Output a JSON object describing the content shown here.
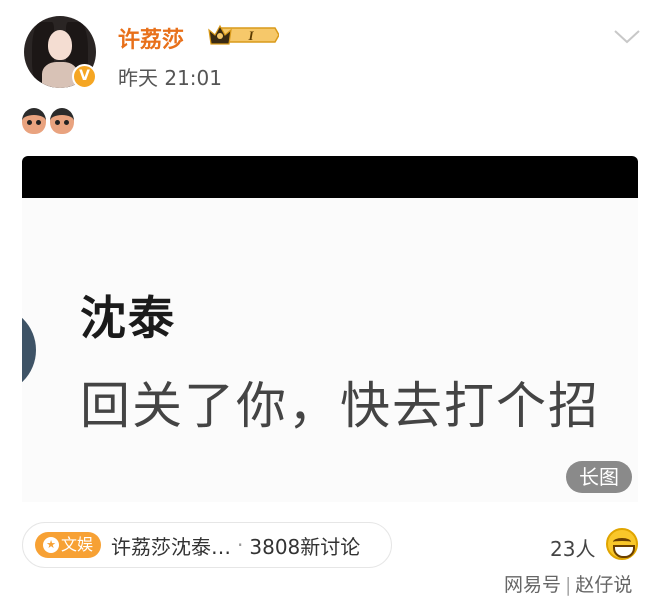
{
  "post": {
    "username": "许荔莎",
    "vip_level": "I",
    "verified_symbol": "V",
    "timestamp": "昨天 21:01"
  },
  "image": {
    "contact_name": "沈泰",
    "message": "回关了你，快去打个招",
    "long_image_label": "长图"
  },
  "topic": {
    "tag_label": "文娱",
    "title": "许荔莎沈泰…",
    "separator": "·",
    "discussion_count": "3808新讨论"
  },
  "reactions": {
    "people_count": "23人"
  },
  "watermark": {
    "source": "网易号",
    "separator": "|",
    "author": "赵仔说"
  },
  "colors": {
    "username": "#e8701a",
    "topic_tag": "#f7a134"
  },
  "icons": [
    "vip-crown-icon",
    "chevron-down-icon",
    "verified-icon",
    "grin-emoji-icon"
  ]
}
